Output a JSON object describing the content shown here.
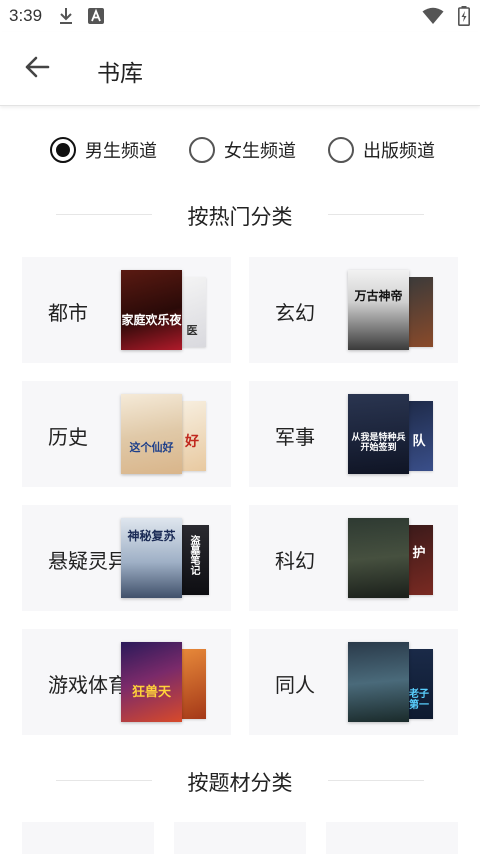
{
  "status_bar": {
    "time": "3:39",
    "icons": [
      "download-icon",
      "a-badge-icon",
      "wifi-icon",
      "battery-icon"
    ]
  },
  "app_bar": {
    "back_icon": "arrow-left-icon",
    "title": "书库"
  },
  "channels": [
    {
      "label": "男生频道",
      "selected": true
    },
    {
      "label": "女生频道",
      "selected": false
    },
    {
      "label": "出版频道",
      "selected": false
    }
  ],
  "hot_section": {
    "title": "按热门分类",
    "categories": [
      {
        "label": "都市",
        "cover_front_text": "家庭欢乐夜",
        "cover_back_text": "医"
      },
      {
        "label": "玄幻",
        "cover_front_text": "万古神帝",
        "cover_back_text": ""
      },
      {
        "label": "历史",
        "cover_front_text": "这个仙好",
        "cover_back_text": "好"
      },
      {
        "label": "军事",
        "cover_front_text": "从我是特种兵开始签到",
        "cover_back_text": "队"
      },
      {
        "label": "悬疑灵异",
        "cover_front_text": "神秘复苏",
        "cover_back_text": "盗墓笔记"
      },
      {
        "label": "科幻",
        "cover_front_text": "",
        "cover_back_text": "护"
      },
      {
        "label": "游戏体育",
        "cover_front_text": "狂兽天",
        "cover_back_text": ""
      },
      {
        "label": "同人",
        "cover_front_text": "",
        "cover_back_text": "老子第一"
      }
    ]
  },
  "theme_section": {
    "title": "按题材分类"
  },
  "colors": {
    "accent": "#111111",
    "cell_bg": "#f7f7f9"
  }
}
